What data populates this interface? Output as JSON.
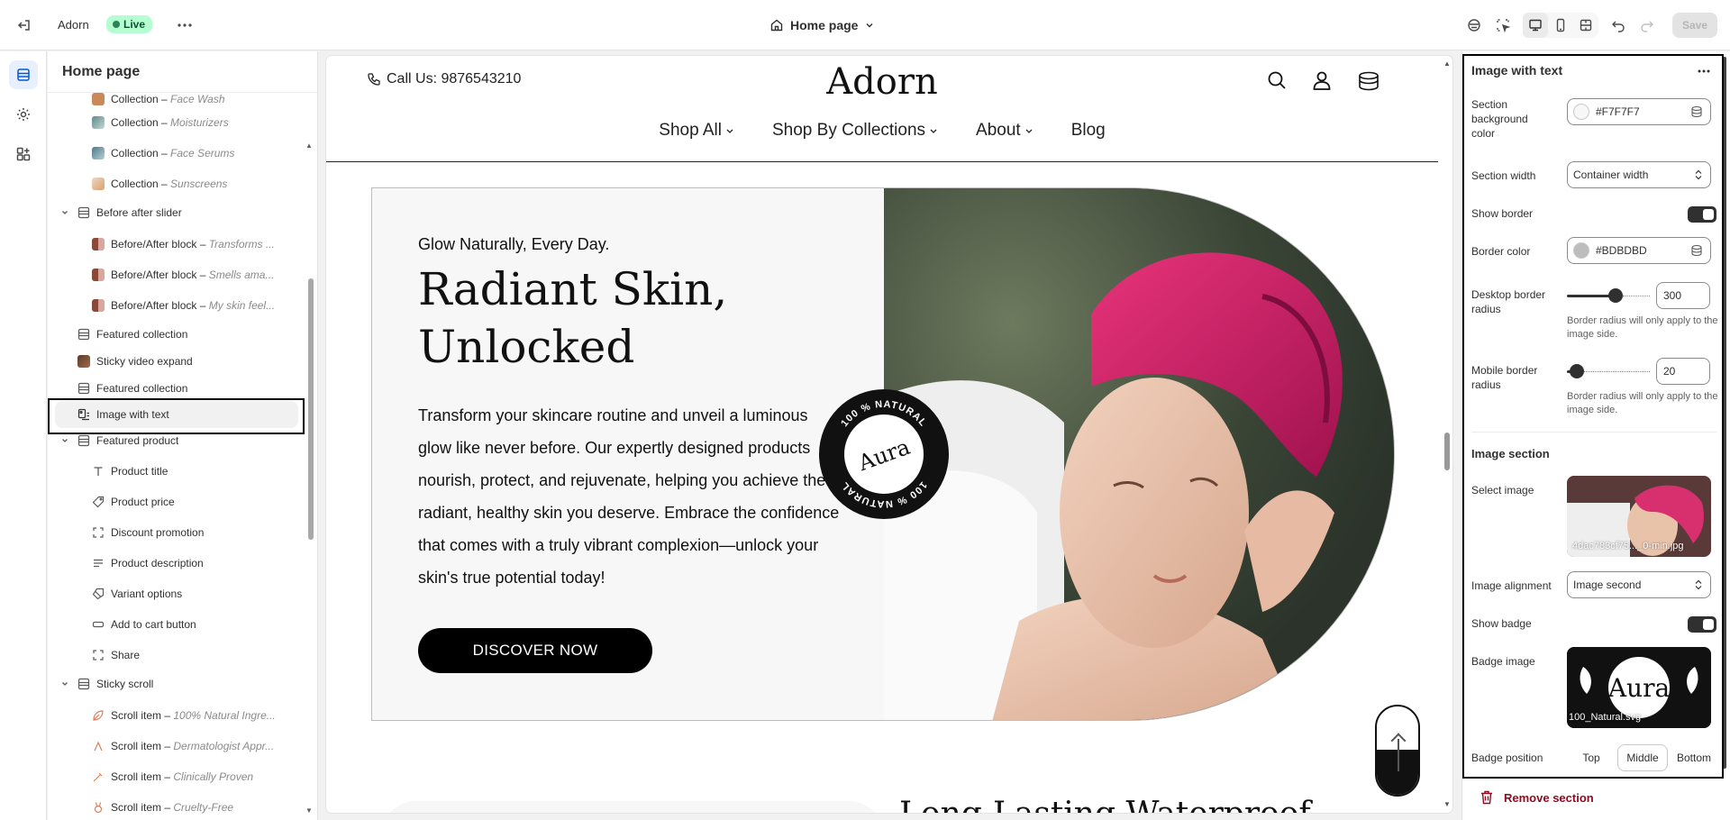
{
  "topbar": {
    "store_name": "Adorn",
    "status_badge": "Live",
    "page_selector": "Home page",
    "save_label": "Save"
  },
  "sidebar": {
    "title": "Home page",
    "rows": [
      {
        "prefix": "Collection – ",
        "italic": "Face Wash",
        "thumb_color": "#c88a5a"
      },
      {
        "prefix": "Collection – ",
        "italic": "Moisturizers",
        "thumb_color": "#7a9a9a"
      },
      {
        "prefix": "Collection – ",
        "italic": "Face Serums",
        "thumb_color": "#6e8f9a"
      },
      {
        "prefix": "Collection – ",
        "italic": "Sunscreens",
        "thumb_color": "#e8c8a8"
      },
      {
        "label": "Before after slider"
      },
      {
        "prefix": "Before/After block – ",
        "italic": "Transforms ..."
      },
      {
        "prefix": "Before/After block – ",
        "italic": "Smells ama..."
      },
      {
        "prefix": "Before/After block – ",
        "italic": "My skin feel..."
      },
      {
        "label": "Featured collection"
      },
      {
        "label": "Sticky video expand"
      },
      {
        "label": "Featured collection"
      },
      {
        "label": "Image with text"
      },
      {
        "label": "Featured product"
      },
      {
        "label": "Product title"
      },
      {
        "label": "Product price"
      },
      {
        "label": "Discount promotion"
      },
      {
        "label": "Product description"
      },
      {
        "label": "Variant options"
      },
      {
        "label": "Add to cart button"
      },
      {
        "label": "Share"
      },
      {
        "label": "Sticky scroll"
      },
      {
        "prefix": "Scroll item – ",
        "italic": "100% Natural Ingre..."
      },
      {
        "prefix": "Scroll item – ",
        "italic": "Dermatologist Appr..."
      },
      {
        "prefix": "Scroll item – ",
        "italic": "Clinically Proven"
      },
      {
        "prefix": "Scroll item – ",
        "italic": "Cruelty-Free"
      }
    ]
  },
  "preview": {
    "call": "Call Us: 9876543210",
    "logo": "Adorn",
    "nav": [
      "Shop All",
      "Shop By Collections",
      "About",
      "Blog"
    ],
    "subheading": "Glow Naturally, Every Day.",
    "heading": "Radiant Skin, Unlocked",
    "body": "Transform your skincare routine and unveil a luminous glow like never before. Our expertly designed products nourish, protect, and rejuvenate, helping you achieve the radiant, healthy skin you deserve. Embrace the confidence that comes with a truly vibrant complexion—unlock your skin's true potential today!",
    "button": "DISCOVER NOW",
    "badge": {
      "center": "Aura",
      "ring_top": "100 % NATURAL",
      "ring_bottom": "100 % NATURAL"
    },
    "next_heading": "Long-Lasting Waterproof"
  },
  "settings": {
    "title": "Image with text",
    "bg_color_label": "Section background color",
    "bg_color_value": "#F7F7F7",
    "width_label": "Section width",
    "width_value": "Container width",
    "show_border_label": "Show border",
    "show_border": true,
    "border_color_label": "Border color",
    "border_color_value": "#BDBDBD",
    "desktop_radius_label": "Desktop border radius",
    "desktop_radius_value": "300",
    "desktop_radius_fraction": 0.6,
    "radius_help": "Border radius will only apply to the image side.",
    "mobile_radius_label": "Mobile border radius",
    "mobile_radius_value": "20",
    "mobile_radius_fraction": 0.04,
    "image_section_heading": "Image section",
    "select_image_label": "Select image",
    "image_filename": "4dac783cf75..._0-min.jpg",
    "alignment_label": "Image alignment",
    "alignment_value": "Image second",
    "show_badge_label": "Show badge",
    "show_badge": true,
    "badge_image_label": "Badge image",
    "badge_filename": "100_Natural.svg",
    "badge_preview_text": "Aura",
    "badge_position_label": "Badge position",
    "badge_positions": [
      "Top",
      "Middle",
      "Bottom"
    ],
    "badge_position_selected": "Middle",
    "remove_label": "Remove section"
  },
  "colors": {
    "live_badge_bg": "#b4fed2",
    "section_bg": "#F7F7F7",
    "border": "#BDBDBD",
    "remove_red": "#8e0b21"
  }
}
